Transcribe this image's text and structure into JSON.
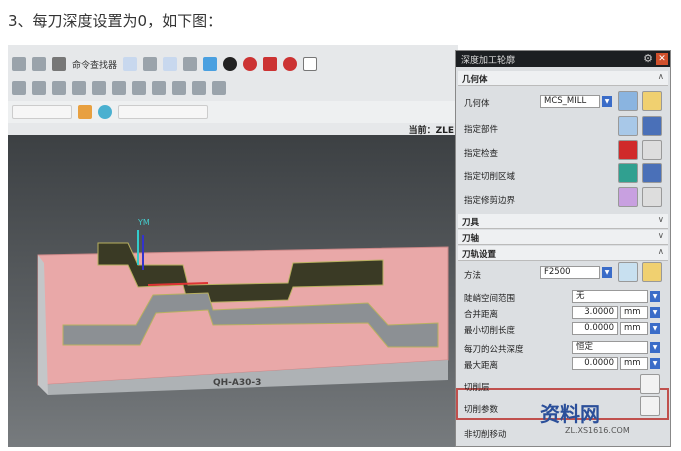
{
  "caption": "3、每刀深度设置为0，如下图：",
  "toolbar": {
    "command_finder": "命令查找器",
    "current_label": "当前：ZLE"
  },
  "viewport": {
    "axis_label": "YM",
    "part_label": "QH-A30-3"
  },
  "dialog": {
    "title": "深度加工轮廓",
    "sections": {
      "geometry": "几何体",
      "tool": "刀具",
      "axis": "刀轴",
      "path_settings": "刀轨设置"
    },
    "geometry": {
      "label": "几何体",
      "value": "MCS_MILL",
      "specify_part": "指定部件",
      "specify_check": "指定检查",
      "specify_cut_area": "指定切削区域",
      "specify_trim": "指定修剪边界"
    },
    "path": {
      "method_label": "方法",
      "method_value": "F2500",
      "steep_label": "陡峭空间范围",
      "steep_value": "无",
      "merge_label": "合并距离",
      "merge_value": "3.0000",
      "merge_unit": "mm",
      "min_cut_label": "最小切削长度",
      "min_cut_value": "0.0000",
      "min_cut_unit": "mm",
      "depth_label": "每刀的公共深度",
      "depth_value": "恒定",
      "max_dist_label": "最大距离",
      "max_dist_value": "0.0000",
      "max_dist_unit": "mm",
      "cut_levels": "切削层",
      "cut_params": "切削参数",
      "non_cut": "非切削移动"
    },
    "highlight_color": "#c0504d"
  },
  "watermark": {
    "text": "资料网",
    "url": "ZL.XS1616.COM"
  }
}
